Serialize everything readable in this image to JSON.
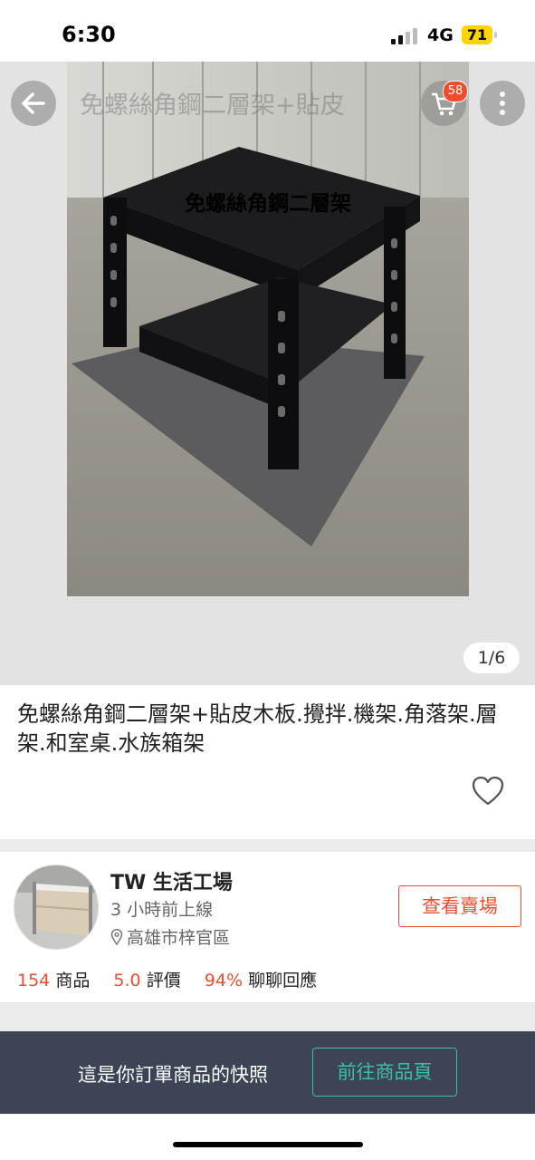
{
  "status_bar": {
    "time": "6:30",
    "network": "4G",
    "battery": "71"
  },
  "header": {
    "title": "免螺絲角鋼二層架+貼皮",
    "cart_count": "58",
    "back_icon": "back-arrow-icon",
    "cart_icon": "shopping-cart-icon",
    "more_icon": "more-dots-icon"
  },
  "gallery": {
    "image_caption": "免螺絲角鋼二層架",
    "page_indicator": "1/6"
  },
  "product": {
    "title": "免螺絲角鋼二層架+貼皮木板.攪拌.機架.角落架.層架.和室桌.水族箱架",
    "favorite_icon": "heart-icon"
  },
  "seller": {
    "name": "TW 生活工場",
    "last_online": "3 小時前上線",
    "location": "高雄市梓官區",
    "view_shop_label": "查看賣場",
    "stats": {
      "products_value": "154",
      "products_label": "商品",
      "rating_value": "5.0",
      "rating_label": "評價",
      "chat_value": "94%",
      "chat_label": "聊聊回應"
    }
  },
  "bottom_bar": {
    "snapshot_text": "這是你訂單商品的快照",
    "goto_label": "前往商品頁"
  },
  "colors": {
    "accent": "#ee4d2d",
    "bottom_bar": "#3c4456",
    "teal": "#3bbfa5"
  }
}
